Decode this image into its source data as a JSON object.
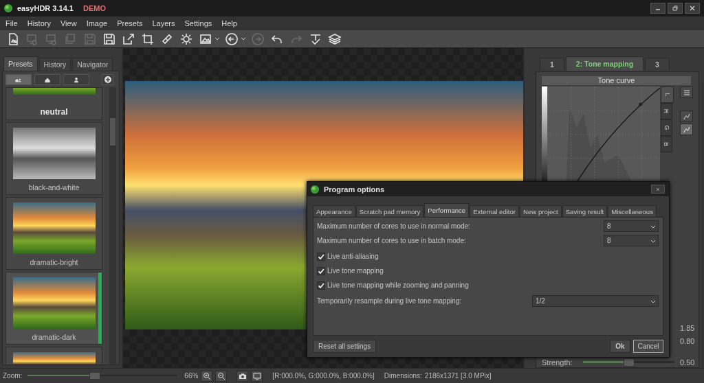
{
  "window": {
    "title": "easyHDR 3.14.1",
    "badge": "DEMO"
  },
  "menu": [
    "File",
    "History",
    "View",
    "Image",
    "Presets",
    "Layers",
    "Settings",
    "Help"
  ],
  "toolbar": [
    {
      "kind": "new-image",
      "disabled": false
    },
    {
      "kind": "batch",
      "disabled": true
    },
    {
      "kind": "batch",
      "disabled": true
    },
    {
      "kind": "stack",
      "disabled": true
    },
    {
      "kind": "save",
      "disabled": true
    },
    {
      "kind": "save",
      "disabled": false
    },
    {
      "kind": "export",
      "disabled": false
    },
    {
      "kind": "crop",
      "disabled": false
    },
    {
      "kind": "bandage",
      "disabled": false
    },
    {
      "kind": "gear",
      "disabled": false
    },
    {
      "kind": "image-menu",
      "disabled": false
    },
    {
      "kind": "back-menu",
      "disabled": false
    },
    {
      "kind": "forward",
      "disabled": true
    },
    {
      "kind": "undo",
      "disabled": false
    },
    {
      "kind": "redo",
      "disabled": true
    },
    {
      "kind": "clear",
      "disabled": false
    },
    {
      "kind": "layers",
      "disabled": false
    }
  ],
  "left_panel": {
    "tabs": [
      {
        "label": "Presets",
        "selected": true
      },
      {
        "label": "History",
        "selected": false
      },
      {
        "label": "Navigator",
        "selected": false
      }
    ],
    "filters": [
      {
        "kind": "all",
        "selected": true
      },
      {
        "kind": "builtin",
        "selected": false
      },
      {
        "kind": "user",
        "selected": false
      }
    ],
    "presets": [
      {
        "name": "neutral",
        "kind": "partial-top",
        "selected": false
      },
      {
        "name": "black-and-white",
        "kind": "mono",
        "selected": false
      },
      {
        "name": "dramatic-bright",
        "kind": "color",
        "selected": false
      },
      {
        "name": "dramatic-dark",
        "kind": "color",
        "selected": true
      },
      {
        "kind": "partial-bottom",
        "selected": false
      }
    ]
  },
  "right_panel": {
    "tabs": [
      {
        "label": "1",
        "selected": false
      },
      {
        "label": "2: Tone mapping",
        "selected": true
      },
      {
        "label": "3",
        "selected": false
      }
    ],
    "curve_title": "Tone curve",
    "channels": [
      {
        "label": "L",
        "selected": true
      },
      {
        "label": "R",
        "selected": false
      },
      {
        "label": "G",
        "selected": false
      },
      {
        "label": "B",
        "selected": false
      }
    ],
    "values": [
      "1.85",
      "0.80"
    ],
    "strength": {
      "label": "Strength:",
      "level": 0.5,
      "reading": "0.50"
    }
  },
  "dialog": {
    "title": "Program options",
    "tabs": [
      {
        "label": "Appearance",
        "selected": false
      },
      {
        "label": "Scratch pad memory",
        "selected": false
      },
      {
        "label": "Performance",
        "selected": true
      },
      {
        "label": "External editor",
        "selected": false
      },
      {
        "label": "New project",
        "selected": false
      },
      {
        "label": "Saving result",
        "selected": false
      },
      {
        "label": "Miscellaneous",
        "selected": false
      }
    ],
    "settings": [
      {
        "kind": "select",
        "label": "Maximum number of cores to use in normal mode:",
        "value": "8"
      },
      {
        "kind": "select",
        "label": "Maximum number of cores to use in batch mode:",
        "value": "8"
      },
      {
        "kind": "check",
        "label": "Live anti-aliasing",
        "checked": true
      },
      {
        "kind": "check",
        "label": "Live tone mapping",
        "checked": true
      },
      {
        "kind": "check",
        "label": "Live tone mapping while zooming and panning",
        "checked": true
      },
      {
        "kind": "wide-select",
        "label": "Temporarily resample during live tone mapping:",
        "value": "1/2"
      }
    ],
    "reset": "Reset all settings",
    "ok": "Ok",
    "cancel": "Cancel"
  },
  "status_bar": {
    "zoom_label": "Zoom:",
    "zoom": {
      "level": 0.45
    },
    "zoom_value": "66%",
    "pixel": "[R:000.0%, G:000.0%, B:000.0%]",
    "dimensions_label": "Dimensions:",
    "dimensions": "2186x1371 [3.0 MPix]"
  }
}
